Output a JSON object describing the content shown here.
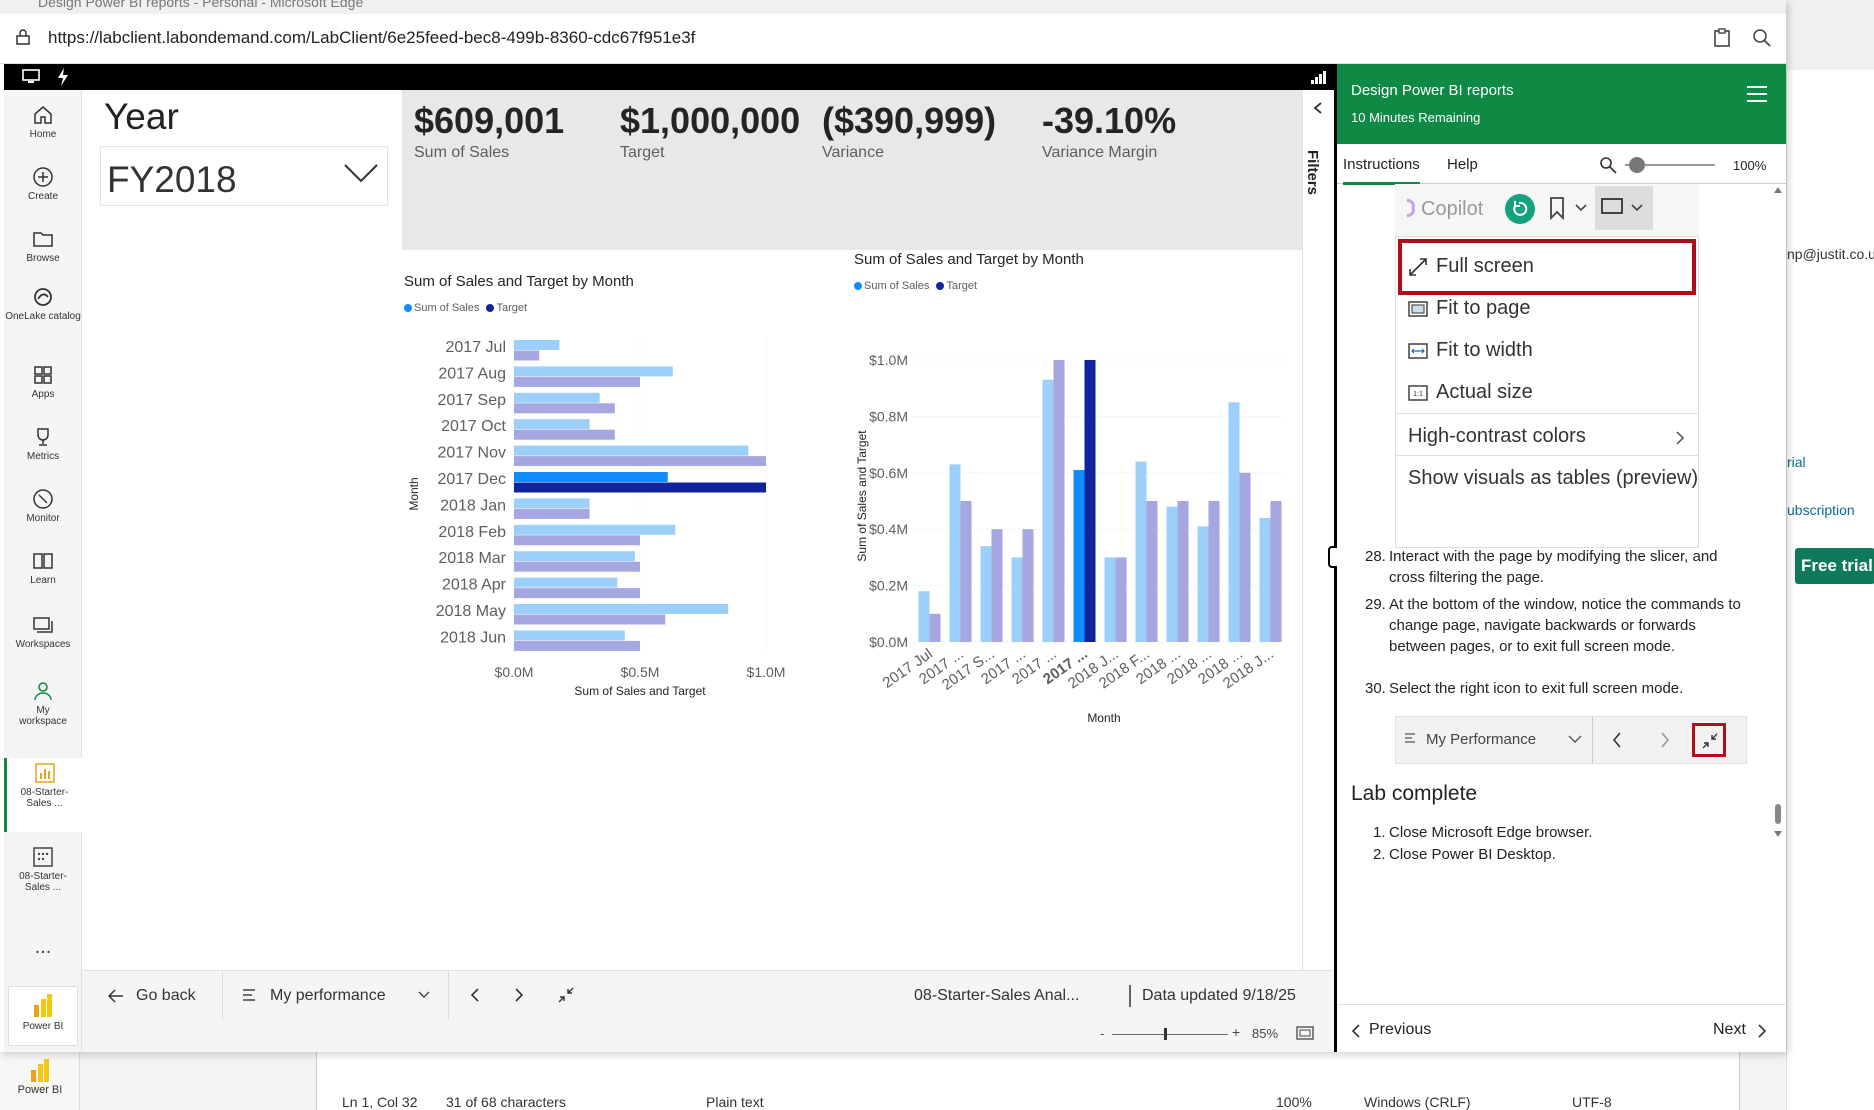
{
  "window": {
    "title": "Design Power BI reports - Personal - Microsoft Edge",
    "url": "https://labclient.labondemand.com/LabClient/6e25feed-bec8-499b-8360-cdc67f951e3f"
  },
  "nav": {
    "items": [
      {
        "label": "Home",
        "icon": "home-icon"
      },
      {
        "label": "Create",
        "icon": "plus-circle-icon"
      },
      {
        "label": "Browse",
        "icon": "folder-icon"
      },
      {
        "label": "OneLake catalog",
        "icon": "onelake-icon"
      },
      {
        "label": "Apps",
        "icon": "apps-icon"
      },
      {
        "label": "Metrics",
        "icon": "trophy-icon"
      },
      {
        "label": "Monitor",
        "icon": "monitor-icon"
      },
      {
        "label": "Learn",
        "icon": "book-icon"
      },
      {
        "label": "Workspaces",
        "icon": "workspaces-icon"
      },
      {
        "label": "My workspace",
        "icon": "user-icon"
      },
      {
        "label": "08-Starter-Sales ...",
        "icon": "report-icon"
      },
      {
        "label": "08-Starter-Sales ...",
        "icon": "semantic-model-icon"
      }
    ],
    "more": "...",
    "powerbi": "Power BI",
    "powerbi_taskbar": "Power BI"
  },
  "slicer": {
    "title": "Year",
    "value": "FY2018"
  },
  "kpis": [
    {
      "value": "$609,001",
      "label": "Sum of Sales"
    },
    {
      "value": "$1,000,000",
      "label": "Target"
    },
    {
      "value": "($390,999)",
      "label": "Variance"
    },
    {
      "value": "-39.10%",
      "label": "Variance Margin"
    }
  ],
  "filters_label": "Filters",
  "chart_data": [
    {
      "type": "bar",
      "orientation": "horizontal",
      "title": "Sum of Sales and Target by Month",
      "xlabel": "Sum of Sales and Target",
      "ylabel": "Month",
      "xlim": [
        0,
        1.0
      ],
      "x_ticks": [
        "$0.0M",
        "$0.5M",
        "$1.0M"
      ],
      "legend": [
        "Sum of Sales",
        "Target"
      ],
      "legend_position": "top-left",
      "categories": [
        "2017 Jul",
        "2017 Aug",
        "2017 Sep",
        "2017 Oct",
        "2017 Nov",
        "2017 Dec",
        "2018 Jan",
        "2018 Feb",
        "2018 Mar",
        "2018 Apr",
        "2018 May",
        "2018 Jun"
      ],
      "highlighted": "2017 Dec",
      "series": [
        {
          "name": "Sum of Sales",
          "color": "#9cd0fb",
          "highlight_color": "#118dff",
          "values": [
            0.18,
            0.63,
            0.34,
            0.3,
            0.93,
            0.61,
            0.3,
            0.64,
            0.48,
            0.41,
            0.85,
            0.44
          ]
        },
        {
          "name": "Target",
          "color": "#a6a6e0",
          "highlight_color": "#12239e",
          "values": [
            0.1,
            0.5,
            0.4,
            0.4,
            1.0,
            1.0,
            0.3,
            0.5,
            0.5,
            0.5,
            0.6,
            0.5
          ]
        }
      ]
    },
    {
      "type": "bar",
      "orientation": "vertical",
      "title": "Sum of Sales and Target by Month",
      "xlabel": "Month",
      "ylabel": "Sum of Sales and Target",
      "ylim": [
        0,
        1.0
      ],
      "y_ticks": [
        "$0.0M",
        "$0.2M",
        "$0.4M",
        "$0.6M",
        "$0.8M",
        "$1.0M"
      ],
      "legend": [
        "Sum of Sales",
        "Target"
      ],
      "legend_position": "top-left",
      "x_tick_labels": [
        "2017 Jul",
        "2017 ...",
        "2017 S...",
        "2017 ...",
        "2017 ...",
        "2017 ...",
        "2018 J...",
        "2018 F...",
        "2018 ...",
        "2018 ...",
        "2018 ...",
        "2018 J..."
      ],
      "highlighted_index": 5,
      "series": [
        {
          "name": "Sum of Sales",
          "color": "#9cd0fb",
          "highlight_color": "#118dff",
          "values": [
            0.18,
            0.63,
            0.34,
            0.3,
            0.93,
            0.61,
            0.3,
            0.64,
            0.48,
            0.41,
            0.85,
            0.44
          ]
        },
        {
          "name": "Target",
          "color": "#a6a6e0",
          "highlight_color": "#12239e",
          "values": [
            0.1,
            0.5,
            0.4,
            0.4,
            1.0,
            1.0,
            0.3,
            0.5,
            0.5,
            0.5,
            0.6,
            0.5
          ]
        }
      ]
    }
  ],
  "bottom": {
    "go_back": "Go back",
    "page": "My performance",
    "report_name": "08-Starter-Sales Anal...",
    "updated": "Data updated 9/18/25",
    "zoom": "85%"
  },
  "lab": {
    "title": "Design Power BI reports",
    "remaining": "10 Minutes Remaining",
    "tabs": [
      "Instructions",
      "Help"
    ],
    "zoom": "100%",
    "shot": {
      "copilot": "Copilot",
      "items": [
        "Full screen",
        "Fit to page",
        "Fit to width",
        "Actual size",
        "High-contrast colors",
        "Show visuals as tables (preview)"
      ]
    },
    "steps": [
      {
        "num": "28.",
        "text": "Interact with the page by modifying the slicer, and cross filtering the page."
      },
      {
        "num": "29.",
        "text": "At the bottom of the window, notice the commands to change page, navigate backwards or forwards between pages, or to exit full screen mode."
      },
      {
        "num": "30.",
        "text": "Select the right icon to exit full screen mode."
      }
    ],
    "mininav_page": "My Performance",
    "complete_title": "Lab complete",
    "final_steps": [
      {
        "num": "1.",
        "text": "Close Microsoft Edge browser."
      },
      {
        "num": "2.",
        "text": "Close Power BI Desktop."
      }
    ],
    "previous": "Previous",
    "next": "Next"
  },
  "background": {
    "email_fragment": "np@justit.co.u",
    "trial_link": "rial",
    "subscription": "ubscription",
    "free_trial": "Free trial",
    "status": [
      "Ln 1, Col 32",
      "31 of 68 characters",
      "Plain text",
      "100%",
      "Windows (CRLF)",
      "UTF-8"
    ]
  }
}
